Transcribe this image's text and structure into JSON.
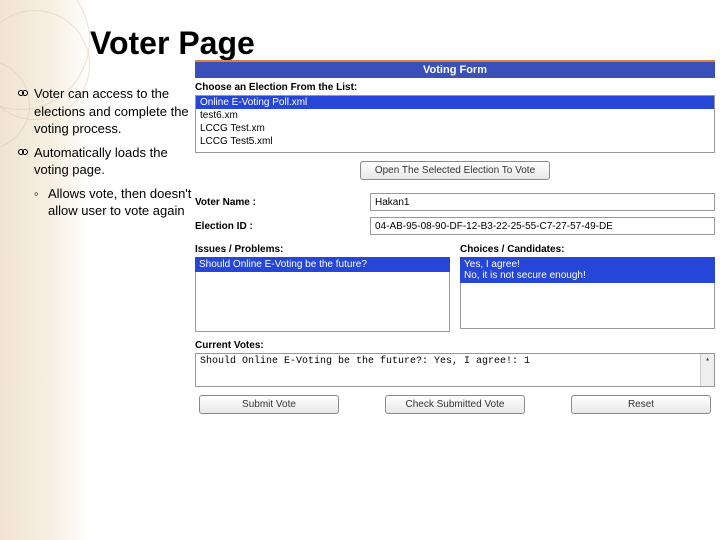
{
  "slide": {
    "title": "Voter Page",
    "bullets": {
      "b1": "Voter can access to the elections and complete the voting process.",
      "b2": "Automatically loads the voting page.",
      "b3": "Allows vote, then doesn't allow user to vote again"
    }
  },
  "form": {
    "title": "Voting Form",
    "choose_label": "Choose an Election From the List:",
    "elections": {
      "e0": "Online E-Voting Poll.xml",
      "e1": "test6.xm",
      "e2": "LCCG Test.xm",
      "e3": "LCCG Test5.xml"
    },
    "open_btn": "Open The Selected Election To Vote",
    "voter_name_label": "Voter Name :",
    "voter_name_value": "Hakan1",
    "election_id_label": "Election ID :",
    "election_id_value": "04-AB-95-08-90-DF-12-B3-22-25-55-C7-27-57-49-DE",
    "issues_label": "Issues / Problems:",
    "issues_header": "Should Online E-Voting be the future?",
    "choices_label": "Choices / Candidates:",
    "choices_header_1": "Yes, I agree!",
    "choices_header_2": "No, it is not secure enough!",
    "current_votes_label": "Current Votes:",
    "current_votes_text": "Should Online E-Voting be the future?:  Yes, I agree!: 1",
    "submit_btn": "Submit Vote",
    "check_btn": "Check Submitted Vote",
    "reset_btn": "Reset"
  }
}
